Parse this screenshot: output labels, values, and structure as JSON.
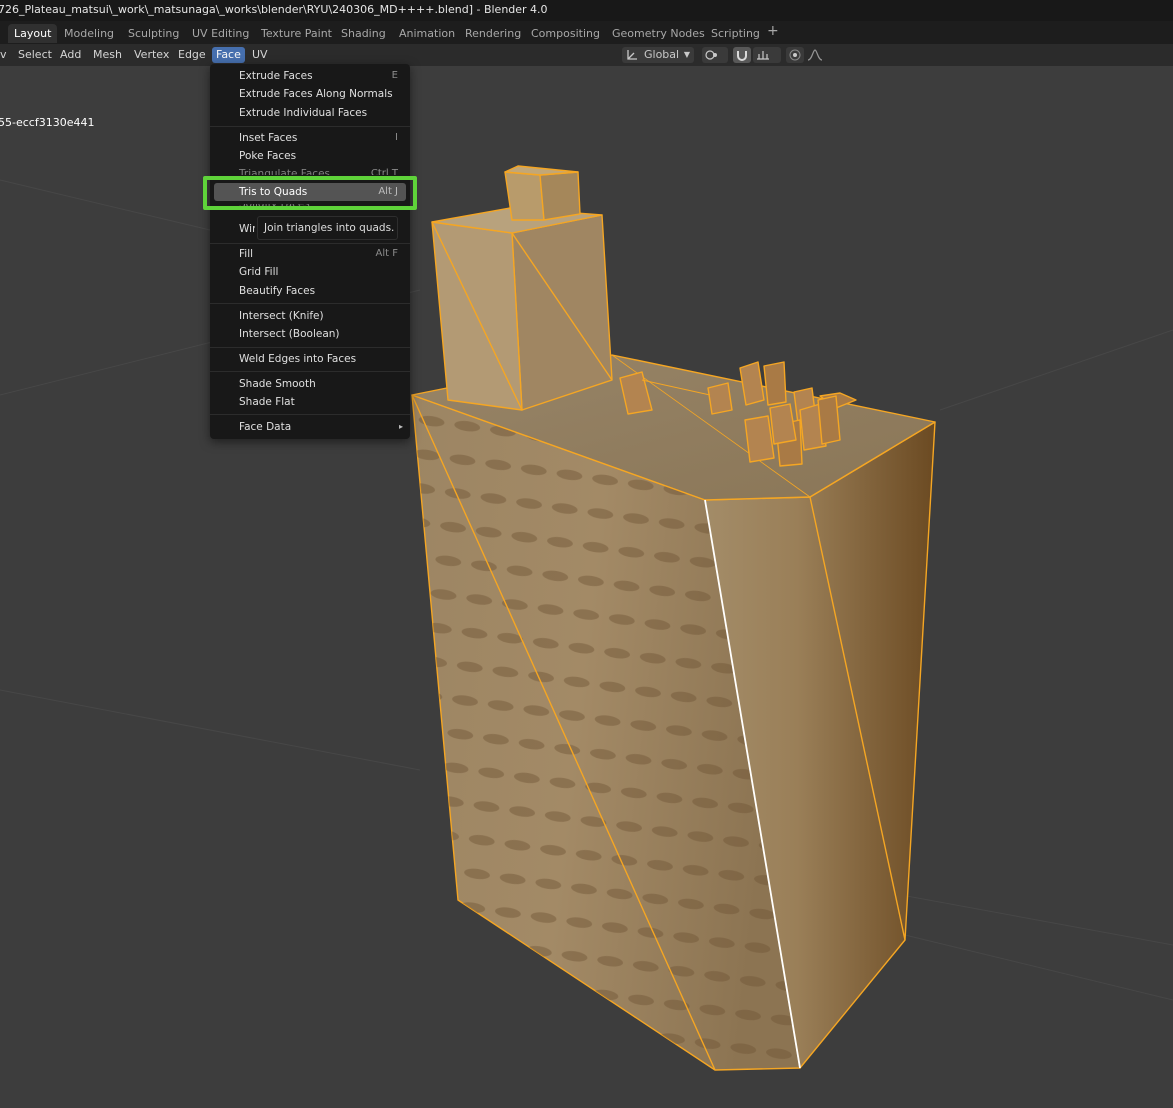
{
  "window": {
    "title": "726_Plateau_matsui\\_work\\_matsunaga\\_works\\blender\\RYU\\240306_MD++++.blend] - Blender 4.0"
  },
  "workspace_tabs": [
    {
      "label": "Layout",
      "active": true
    },
    {
      "label": "Modeling"
    },
    {
      "label": "Sculpting"
    },
    {
      "label": "UV Editing"
    },
    {
      "label": "Texture Paint"
    },
    {
      "label": "Shading"
    },
    {
      "label": "Animation"
    },
    {
      "label": "Rendering"
    },
    {
      "label": "Compositing"
    },
    {
      "label": "Geometry Nodes"
    },
    {
      "label": "Scripting"
    }
  ],
  "add_tab_label": "+",
  "viewport_header": {
    "menus": [
      "v",
      "Select",
      "Add",
      "Mesh",
      "Vertex",
      "Edge",
      "Face",
      "UV"
    ],
    "open_menu": "Face",
    "transform_orientation": "Global",
    "transform_orientation_icon": "orientation-gizmo-icon",
    "pivot_icon": "pivot-point-icon",
    "snap_icon": "magnet-icon",
    "snap_target_icon": "snap-increment-icon",
    "proportional_icon": "proportional-edit-icon",
    "falloff_icon": "falloff-curve-icon"
  },
  "viewport": {
    "object_label": "55-eccf3130e441",
    "selection_color": "#f5a623",
    "active_edge_color": "#ffffff"
  },
  "face_menu": {
    "items": [
      {
        "label": "Extrude Faces",
        "shortcut": "E"
      },
      {
        "label": "Extrude Faces Along Normals",
        "shortcut": ""
      },
      {
        "label": "Extrude Individual Faces",
        "shortcut": ""
      },
      {
        "label": "Inset Faces",
        "shortcut": "I"
      },
      {
        "label": "Poke Faces",
        "shortcut": ""
      },
      {
        "label": "Triangulate Faces",
        "shortcut": "Ctrl T"
      },
      {
        "label": "Tris to Quads",
        "shortcut": "Alt J",
        "highlighted": true
      },
      {
        "label": "Solidify Faces",
        "shortcut": ""
      },
      {
        "label": "Wireframe",
        "shortcut": ""
      },
      {
        "label": "Fill",
        "shortcut": "Alt F"
      },
      {
        "label": "Grid Fill",
        "shortcut": ""
      },
      {
        "label": "Beautify Faces",
        "shortcut": ""
      },
      {
        "label": "Intersect (Knife)",
        "shortcut": ""
      },
      {
        "label": "Intersect (Boolean)",
        "shortcut": ""
      },
      {
        "label": "Weld Edges into Faces",
        "shortcut": ""
      },
      {
        "label": "Shade Smooth",
        "shortcut": ""
      },
      {
        "label": "Shade Flat",
        "shortcut": ""
      },
      {
        "label": "Face Data",
        "shortcut": "",
        "submenu": true
      }
    ],
    "submenu_arrow": "▸",
    "tooltip": "Join triangles into quads.",
    "annotation_color": "#5fd33a"
  }
}
